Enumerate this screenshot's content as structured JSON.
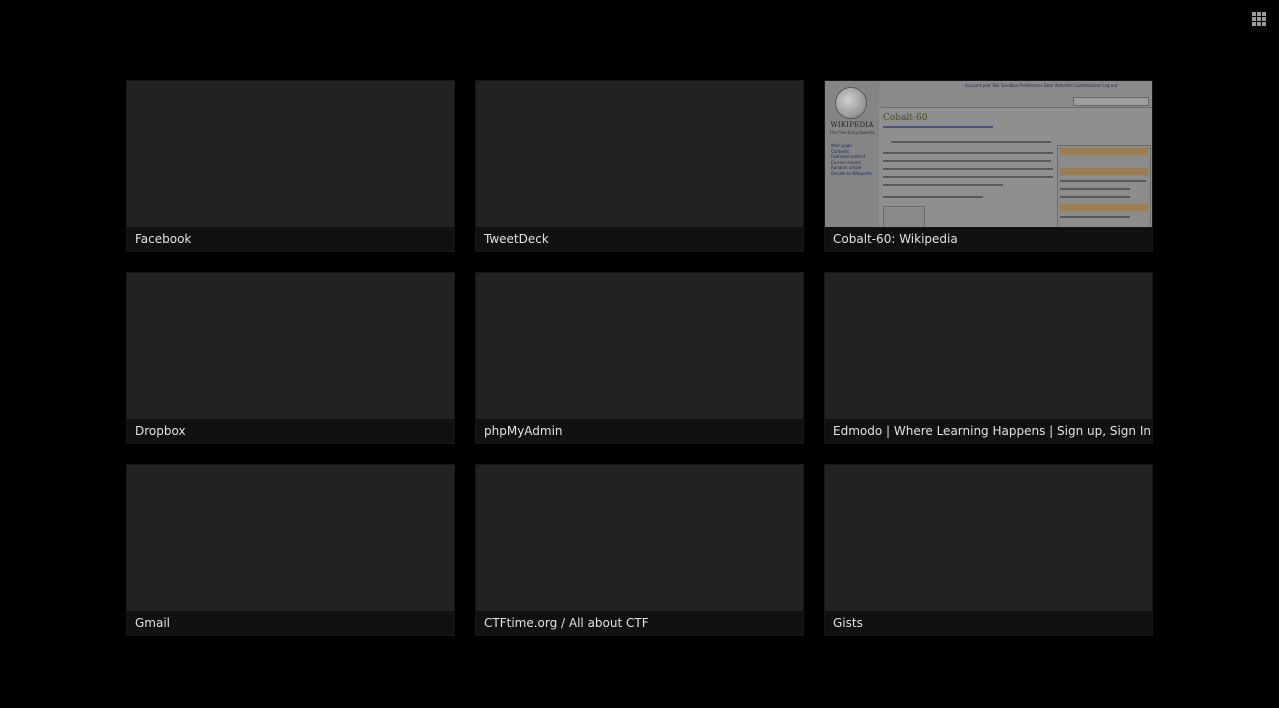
{
  "header": {
    "apps_icon": "apps-grid-icon"
  },
  "tiles": [
    {
      "title": "Facebook",
      "has_preview": false
    },
    {
      "title": "TweetDeck",
      "has_preview": false
    },
    {
      "title": "Cobalt-60: Wikipedia",
      "has_preview": true
    },
    {
      "title": "Dropbox",
      "has_preview": false
    },
    {
      "title": "phpMyAdmin",
      "has_preview": false
    },
    {
      "title": "Edmodo | Where Learning Happens | Sign up, Sign In",
      "has_preview": false
    },
    {
      "title": "Gmail",
      "has_preview": false
    },
    {
      "title": "CTFtime.org / All about CTF",
      "has_preview": false
    },
    {
      "title": "Gists",
      "has_preview": false
    }
  ],
  "wiki_preview": {
    "page_title": "Cobalt-60",
    "logo_text": "WIKIPEDIA",
    "logo_subtext": "The Free Encyclopedia",
    "sidebar_links": [
      "Main page",
      "Contents",
      "Featured content",
      "Current events",
      "Random article",
      "Donate to Wikipedia"
    ],
    "topbar_text": "Account-pref  Talk  Sandbox  Preferences  Beta  Watchlist  Contributions  Log out"
  },
  "colors": {
    "background": "#000000",
    "tile": "#202020",
    "caption_bg": "#111111",
    "caption_text": "#e2e2e2"
  }
}
